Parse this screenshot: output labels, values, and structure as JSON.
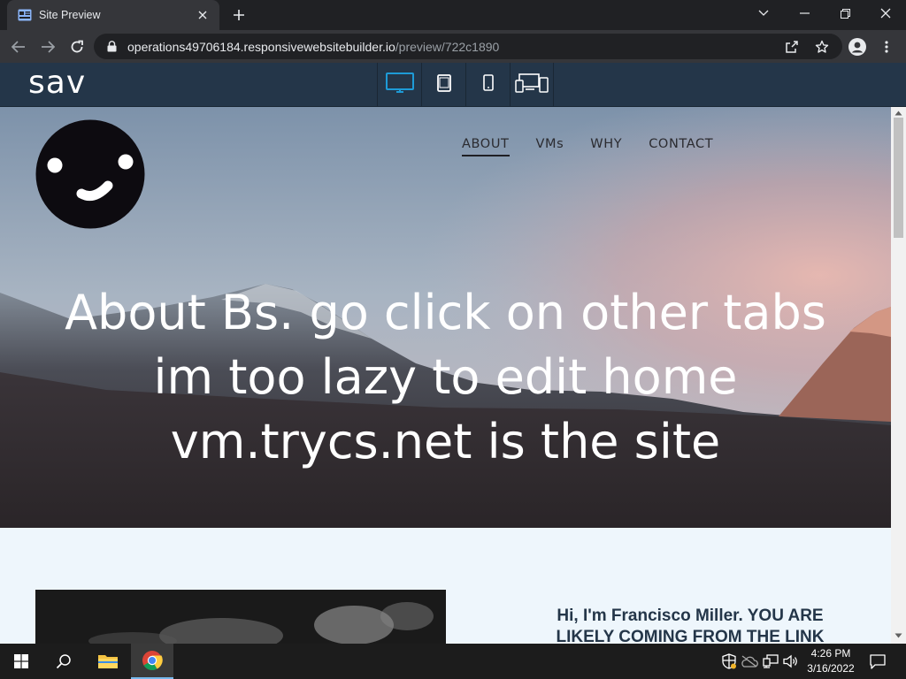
{
  "browser": {
    "tab_title": "Site Preview",
    "url_host": "operations49706184.responsivewebsitebuilder.io",
    "url_path": "/preview/722c1890"
  },
  "builder": {
    "logo": "sav",
    "devices": [
      "desktop-icon",
      "tablet-icon",
      "phone-icon",
      "multi-device-icon"
    ],
    "active_device_color": "#1e9bd7"
  },
  "site": {
    "nav": [
      {
        "label": "ABOUT",
        "active": true
      },
      {
        "label": "VMs",
        "active": false
      },
      {
        "label": "WHY",
        "active": false
      },
      {
        "label": "CONTACT",
        "active": false
      }
    ],
    "hero_lines": [
      "About Bs. go click on other tabs",
      "im too lazy to edit home",
      "vm.trycs.net is the site"
    ],
    "intro_lines": [
      "Hi, I'm Francisco Miller.  YOU ARE",
      "LIKELY COMING FROM THE LINK"
    ]
  },
  "taskbar": {
    "time": "4:26 PM",
    "date": "3/16/2022",
    "apps": [
      "file-explorer-icon",
      "chrome-icon"
    ]
  },
  "colors": {
    "builder_bar": "#243649",
    "intro_text": "#243649",
    "page_bg": "#eef6fc"
  }
}
